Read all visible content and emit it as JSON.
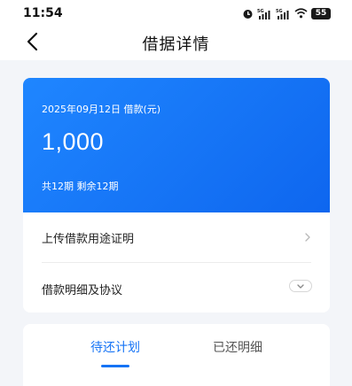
{
  "status_bar": {
    "time": "11:54",
    "battery": "55",
    "icons": [
      "alarm-icon",
      "signal-5g-icon",
      "signal-5g-icon",
      "wifi-icon",
      "battery-icon"
    ]
  },
  "header": {
    "title": "借据详情",
    "back_icon": "chevron-left-icon"
  },
  "loan": {
    "subtitle": "2025年09月12日 借款(元)",
    "amount": "1,000",
    "terms": "共12期  剩余12期",
    "accent_color": "#1573f5"
  },
  "menu": {
    "upload_proof": "上传借款用途证明",
    "details_agreement": "借款明细及协议"
  },
  "tabs": {
    "active": "待还计划",
    "inactive": "已还明细"
  }
}
